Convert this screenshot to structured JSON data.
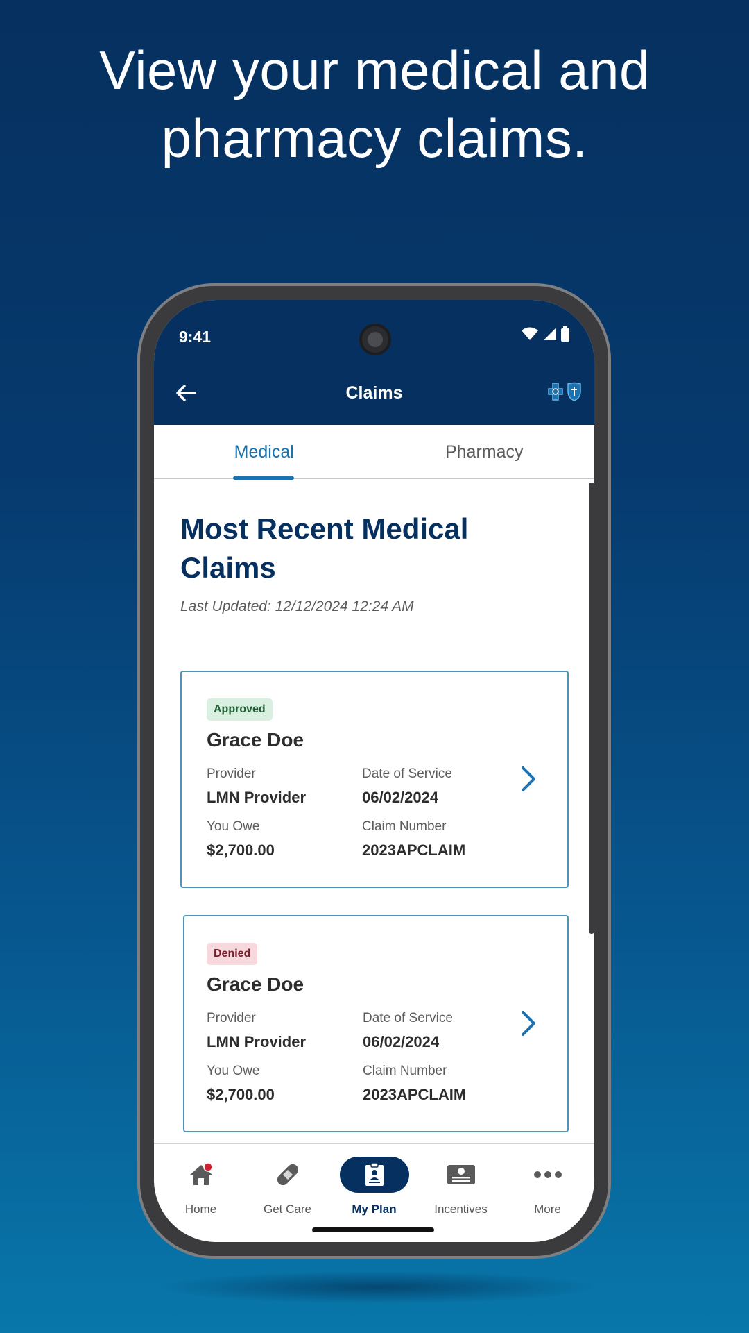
{
  "headline": {
    "line1": "View your medical and",
    "line2": "pharmacy claims."
  },
  "status_bar": {
    "time": "9:41"
  },
  "app_bar": {
    "title": "Claims"
  },
  "tabs": [
    {
      "label": "Medical",
      "active": true
    },
    {
      "label": "Pharmacy",
      "active": false
    }
  ],
  "section": {
    "title": "Most Recent Medical Claims",
    "last_updated": "Last Updated: 12/12/2024 12:24 AM"
  },
  "claims": [
    {
      "status": "Approved",
      "member": "Grace Doe",
      "provider_label": "Provider",
      "provider": "LMN Provider",
      "date_label": "Date of Service",
      "date": "06/02/2024",
      "owe_label": "You Owe",
      "owe": "$2,700.00",
      "claim_label": "Claim Number",
      "claim_number": "2023APCLAIM"
    },
    {
      "status": "Denied",
      "member": "Grace Doe",
      "provider_label": "Provider",
      "provider": "LMN Provider",
      "date_label": "Date of Service",
      "date": "06/02/2024",
      "owe_label": "You Owe",
      "owe": "$2,700.00",
      "claim_label": "Claim Number",
      "claim_number": "2023APCLAIM"
    }
  ],
  "bottom_nav": [
    {
      "label": "Home",
      "icon": "home-icon",
      "active": false
    },
    {
      "label": "Get Care",
      "icon": "bandage-icon",
      "active": false
    },
    {
      "label": "My Plan",
      "icon": "id-card-icon",
      "active": true
    },
    {
      "label": "Incentives",
      "icon": "dollar-card-icon",
      "active": false
    },
    {
      "label": "More",
      "icon": "more-dots-icon",
      "active": false
    }
  ],
  "colors": {
    "brand_navy": "#06305f",
    "accent_blue": "#1a73b0",
    "approved_bg": "#d9efdf",
    "denied_bg": "#f7d9dd",
    "notification_dot": "#d0202e"
  }
}
